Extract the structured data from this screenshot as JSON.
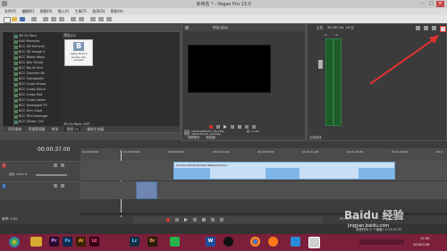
{
  "window": {
    "title": "未命名 * - Vegas Pro 13.0"
  },
  "menu": [
    "文件(F)",
    "编辑(E)",
    "视图(V)",
    "插入(I)",
    "工具(T)",
    "选项(O)",
    "帮助(H)"
  ],
  "explorer": {
    "items": [
      "3D Sx Pack",
      "AAV Manuals",
      "BCC 3D Extrude",
      "BCC 3D Image S",
      "BCC Blobs Warp",
      "BCC Blur Sharp",
      "BCC Burnt Film",
      "BCC Checker Wi",
      "BCC Composite",
      "BCC Cross Dissol",
      "BCC Cross Glitch",
      "BCC Cross Mat",
      "BCC Cross Zoom",
      "BCC Damaged TV",
      "BCC Film Glow",
      "BCC Film Damage",
      "BCC Glitter Cell"
    ],
    "preset_header": "预设(E):",
    "preset_caption": "Apply this to access ALL presets",
    "footer": "3D Sx Pack: DXT",
    "tabs": [
      "项目媒体",
      "资源管理器",
      "转场",
      "视频 FX",
      "媒体生成器"
    ]
  },
  "preview": {
    "quality": "预览(自动)",
    "info_left": [
      "项目: 1920x1080x32, 29.970p",
      "预览: 480x270x32, 29.970p",
      "显示: 480x270x32"
    ],
    "info_right": [
      "帧: 1,109",
      "",
      ""
    ],
    "tabs": [
      "视频预览",
      "修剪器"
    ]
  },
  "mixer": {
    "label": "主控",
    "rate": "48,000 Hz, 16 位",
    "db_values": [
      "-∞",
      "-∞"
    ],
    "footer": "主控总线"
  },
  "timeline": {
    "timecode": "00:00:37.00",
    "ruler": [
      "00:00:00;00",
      "00:00:15;00",
      "00:00:29;29",
      "00:00:44;29",
      "00:00:59;28",
      "00:01:14;28",
      "00:01:29;29",
      "00:01:44;29",
      "00:0"
    ],
    "track1_number": "1",
    "track2_number": "2",
    "level_label": "级别: 100.0 %",
    "clip_name": "2272aec6f44138cfa6b780aed53e2ecc",
    "rate_label": "速率: 0.00",
    "end_time": "00:00:37.00",
    "record_time": "录音时间 (2 个通道): 1:13:47:35"
  },
  "taskbar": {
    "apps": [
      "Pr",
      "Ps",
      "Ai",
      "Id",
      "Lr",
      "Br",
      "W"
    ],
    "apps_colors": [
      "#2a0a2e",
      "#0b2a4a",
      "#3b1f00",
      "#3a0018",
      "#123046",
      "#2b1a0a",
      "#1f4f9c"
    ],
    "clock_time": "12:34",
    "clock_date": "2020/7/16"
  },
  "watermark": {
    "brand": "Baidu 经验",
    "url": "jingyan.baidu.com"
  },
  "accent": "#e03030"
}
